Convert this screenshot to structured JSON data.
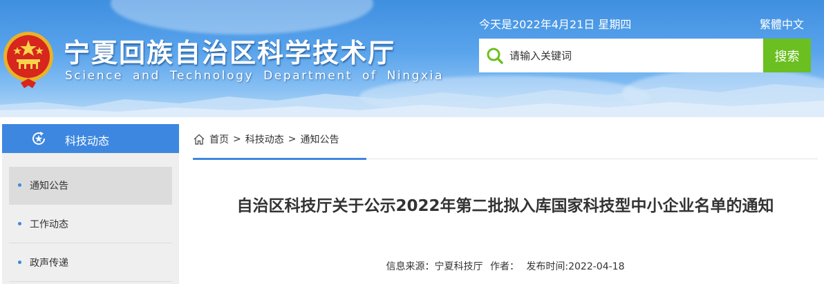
{
  "header": {
    "site_title": "宁夏回族自治区科学技术厅",
    "site_subtitle": "Science and Technology Department of Ningxia",
    "date_text": "今天是2022年4月21日 星期四",
    "lang_link": "繁體中文",
    "search": {
      "placeholder": "请输入关键词",
      "button_label": "搜索"
    }
  },
  "sidebar": {
    "title": "科技动态",
    "items": [
      {
        "label": "通知公告",
        "active": true
      },
      {
        "label": "工作动态",
        "active": false
      },
      {
        "label": "政声传递",
        "active": false
      }
    ]
  },
  "breadcrumb": {
    "items": [
      "首页",
      "科技动态",
      "通知公告"
    ],
    "separator": ">"
  },
  "article": {
    "title": "自治区科技厅关于公示2022年第二批拟入库国家科技型中小企业名单的通知",
    "source_label": "信息来源：宁夏科技厅",
    "author_label": "作者：",
    "date_label": "发布时间:2022-04-18"
  },
  "colors": {
    "accent_blue": "#3d87e0",
    "search_green": "#6bbf20",
    "text": "#333333"
  },
  "icons": {
    "emblem": "national-emblem-icon",
    "search": "search-icon",
    "sidebar_head": "star-refresh-icon",
    "home": "home-icon"
  }
}
